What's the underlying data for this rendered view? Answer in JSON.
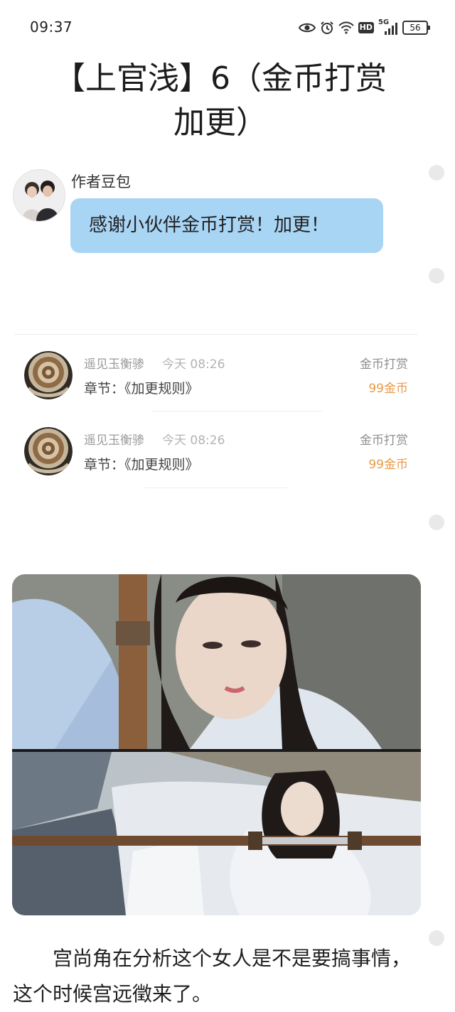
{
  "status_bar": {
    "time": "09:37",
    "network": "5G",
    "hd_label": "HD",
    "battery": "56",
    "icons": [
      "eye-icon",
      "alarm-icon",
      "wifi-icon",
      "hd-icon",
      "signal-icon",
      "battery-icon"
    ]
  },
  "article": {
    "title_line1": "【上官浅】6（金币打赏",
    "title_line2": "加更）"
  },
  "author_message": {
    "name": "作者豆包",
    "text": "感谢小伙伴金币打赏！加更！"
  },
  "tips": [
    {
      "user": "遥见玉衡骖",
      "time": "今天 08:26",
      "chapter": "章节：《加更规则》",
      "type": "金币打赏",
      "amount": "99金币"
    },
    {
      "user": "遥见玉衡骖",
      "time": "今天 08:26",
      "chapter": "章节：《加更规则》",
      "type": "金币打赏",
      "amount": "99金币"
    }
  ],
  "body": {
    "paragraph": "宫尚角在分析这个女人是不是要搞事情，这个时候宫远徵来了。"
  },
  "colors": {
    "bubble": "#a9d5f5",
    "tip_amount": "#e89a46",
    "scroll_dot": "#e9e9e9"
  }
}
